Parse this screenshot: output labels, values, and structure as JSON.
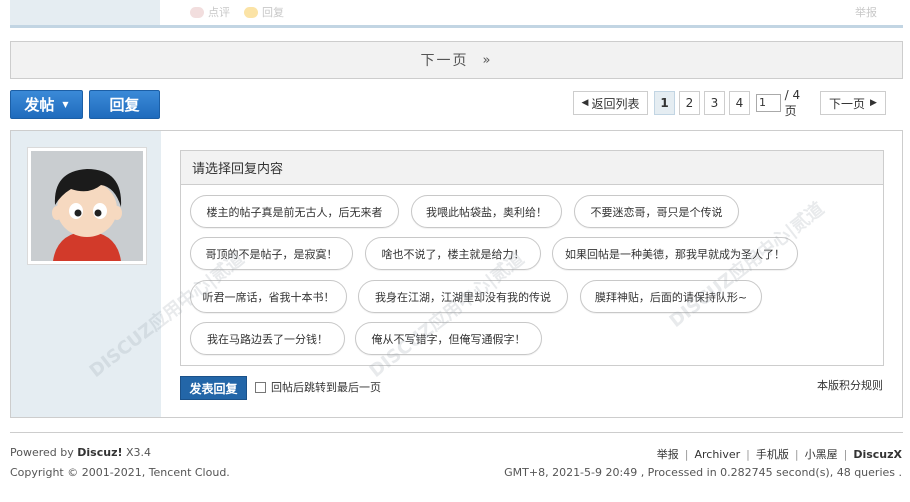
{
  "top_post": {
    "rate_label": "点评",
    "reply_label": "回复",
    "report_label": "举报"
  },
  "next_page": {
    "label": "下一页",
    "arrow": "»"
  },
  "actions": {
    "post_label": "发帖",
    "reply_label": "回复"
  },
  "pager": {
    "back_label": "返回列表",
    "pages": [
      "1",
      "2",
      "3",
      "4"
    ],
    "current_page": "1",
    "input_value": "1",
    "total_label": "/ 4 页",
    "next_label": "下一页"
  },
  "quick_reply": {
    "title": "请选择回复内容",
    "options": [
      "楼主的帖子真是前无古人，后无来者",
      "我喂此帖袋盐，奥利给！",
      "不要迷恋哥，哥只是个传说",
      "哥顶的不是帖子，是寂寞！",
      "啥也不说了，楼主就是给力！",
      "如果回帖是一种美德，那我早就成为圣人了！",
      "听君一席话，省我十本书！",
      "我身在江湖，江湖里却没有我的传说",
      "膜拜神贴，后面的请保持队形~",
      "我在马路边丢了一分钱！",
      "俺从不写错字，但俺写通假字！"
    ],
    "submit_label": "发表回复",
    "jump_label": "回帖后跳转到最后一页",
    "rules_label": "本版积分规则"
  },
  "watermark": {
    "text": "DISCUZ应用中心|贰道",
    "url": "addon.dismall.com"
  },
  "footer": {
    "powered_prefix": "Powered by",
    "powered_brand": "Discuz!",
    "powered_version": "X3.4",
    "copyright": "Copyright © 2001-2021, Tencent Cloud.",
    "links": [
      "举报",
      "Archiver",
      "手机版",
      "小黑屋"
    ],
    "brand": "DiscuzX",
    "stats": "GMT+8, 2021-5-9 20:49 , Processed in 0.282745 second(s), 48 queries ."
  },
  "colors": {
    "button_blue": "#2366a8",
    "side_bg": "#e5edf2"
  }
}
